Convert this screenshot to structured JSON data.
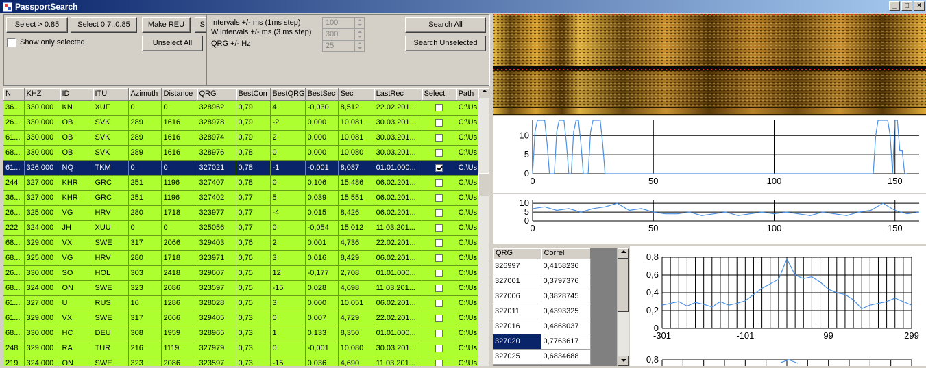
{
  "window": {
    "title": "PassportSearch"
  },
  "toolbar": {
    "select_085": "Select > 0.85",
    "select_07_085": "Select 0.7..0.85",
    "make_reu": "Make REU",
    "s_partial": "S",
    "show_only_selected": "Show only selected",
    "unselect_all": "Unselect All",
    "search_all": "Search All",
    "search_unselected": "Search Unselected"
  },
  "params": {
    "intervals_label": "Intervals +/- ms (1ms step)",
    "intervals_value": "100",
    "w_intervals_label": "W.Intervals +/- ms (3 ms step)",
    "w_intervals_value": "300",
    "qrg_label": "QRG +/- Hz",
    "qrg_value": "25"
  },
  "grid": {
    "columns": [
      "N",
      "KHZ",
      "ID",
      "ITU",
      "Azimuth",
      "Distance",
      "QRG",
      "BestCorr",
      "BestQRG",
      "BestSec",
      "Sec",
      "LastRec",
      "Select",
      "Path"
    ],
    "rows": [
      [
        "36...",
        "330.000",
        "KN",
        "XUF",
        "0",
        "0",
        "328962",
        "0,79",
        "4",
        "-0,030",
        "8,512",
        "22.02.201...",
        false,
        "C:\\Us"
      ],
      [
        "26...",
        "330.000",
        "OB",
        "SVK",
        "289",
        "1616",
        "328978",
        "0,79",
        "-2",
        "0,000",
        "10,081",
        "30.03.201...",
        false,
        "C:\\Us"
      ],
      [
        "61...",
        "330.000",
        "OB",
        "SVK",
        "289",
        "1616",
        "328974",
        "0,79",
        "2",
        "0,000",
        "10,081",
        "30.03.201...",
        false,
        "C:\\Us"
      ],
      [
        "68...",
        "330.000",
        "OB",
        "SVK",
        "289",
        "1616",
        "328976",
        "0,78",
        "0",
        "0,000",
        "10,080",
        "30.03.201...",
        false,
        "C:\\Us"
      ],
      [
        "61...",
        "326.000",
        "NQ",
        "TKM",
        "0",
        "0",
        "327021",
        "0,78",
        "-1",
        "-0,001",
        "8,087",
        "01.01.000...",
        true,
        "C:\\Us"
      ],
      [
        "244",
        "327.000",
        "KHR",
        "GRC",
        "251",
        "1196",
        "327407",
        "0,78",
        "0",
        "0,106",
        "15,486",
        "06.02.201...",
        false,
        "C:\\Us"
      ],
      [
        "36...",
        "327.000",
        "KHR",
        "GRC",
        "251",
        "1196",
        "327402",
        "0,77",
        "5",
        "0,039",
        "15,551",
        "06.02.201...",
        false,
        "C:\\Us"
      ],
      [
        "26...",
        "325.000",
        "VG",
        "HRV",
        "280",
        "1718",
        "323977",
        "0,77",
        "-4",
        "0,015",
        "8,426",
        "06.02.201...",
        false,
        "C:\\Us"
      ],
      [
        "222",
        "324.000",
        "JH",
        "XUU",
        "0",
        "0",
        "325056",
        "0,77",
        "0",
        "-0,054",
        "15,012",
        "11.03.201...",
        false,
        "C:\\Us"
      ],
      [
        "68...",
        "329.000",
        "VX",
        "SWE",
        "317",
        "2066",
        "329403",
        "0,76",
        "2",
        "0,001",
        "4,736",
        "22.02.201...",
        false,
        "C:\\Us"
      ],
      [
        "68...",
        "325.000",
        "VG",
        "HRV",
        "280",
        "1718",
        "323971",
        "0,76",
        "3",
        "0,016",
        "8,429",
        "06.02.201...",
        false,
        "C:\\Us"
      ],
      [
        "26...",
        "330.000",
        "SO",
        "HOL",
        "303",
        "2418",
        "329607",
        "0,75",
        "12",
        "-0,177",
        "2,708",
        "01.01.000...",
        false,
        "C:\\Us"
      ],
      [
        "68...",
        "324.000",
        "ON",
        "SWE",
        "323",
        "2086",
        "323597",
        "0,75",
        "-15",
        "0,028",
        "4,698",
        "11.03.201...",
        false,
        "C:\\Us"
      ],
      [
        "61...",
        "327.000",
        "U",
        "RUS",
        "16",
        "1286",
        "328028",
        "0,75",
        "3",
        "0,000",
        "10,051",
        "06.02.201...",
        false,
        "C:\\Us"
      ],
      [
        "61...",
        "329.000",
        "VX",
        "SWE",
        "317",
        "2066",
        "329405",
        "0,73",
        "0",
        "0,007",
        "4,729",
        "22.02.201...",
        false,
        "C:\\Us"
      ],
      [
        "68...",
        "330.000",
        "HC",
        "DEU",
        "308",
        "1959",
        "328965",
        "0,73",
        "1",
        "0,133",
        "8,350",
        "01.01.000...",
        false,
        "C:\\Us"
      ],
      [
        "248",
        "329.000",
        "RA",
        "TUR",
        "216",
        "1119",
        "327979",
        "0,73",
        "0",
        "-0,001",
        "10,080",
        "30.03.201...",
        false,
        "C:\\Us"
      ],
      [
        "219",
        "324.000",
        "ON",
        "SWE",
        "323",
        "2086",
        "323597",
        "0,73",
        "-15",
        "0,036",
        "4,690",
        "11.03.201...",
        false,
        "C:\\Us"
      ]
    ]
  },
  "corr_list": {
    "columns": [
      "QRG",
      "Correl"
    ],
    "rows": [
      [
        "326997",
        "0,4158236"
      ],
      [
        "327001",
        "0,3797376"
      ],
      [
        "327006",
        "0,3828745"
      ],
      [
        "327011",
        "0,4393325"
      ],
      [
        "327016",
        "0,4868037"
      ],
      [
        "327020",
        "0,7763617"
      ],
      [
        "327025",
        "0,6834688"
      ]
    ],
    "selected_index": 5
  },
  "colors": {
    "grid_row": "#adff2f",
    "selection": "#0a246a",
    "plot_line": "#4a90e2"
  },
  "chart_data": [
    {
      "type": "line",
      "title": "",
      "x": [
        0,
        1,
        2,
        3,
        4,
        5,
        6,
        7,
        8,
        9,
        10,
        11,
        12,
        13,
        14,
        15,
        16,
        17,
        18,
        19,
        20,
        21,
        22,
        23,
        24,
        25,
        26,
        27,
        28,
        29,
        30,
        140,
        141,
        142,
        143,
        144,
        145,
        146,
        147,
        148,
        149,
        150,
        151,
        152,
        153,
        154,
        155
      ],
      "y": [
        0,
        11,
        14,
        14,
        14,
        14,
        8,
        0,
        0,
        0,
        11,
        14,
        14,
        14,
        8,
        0,
        0,
        11,
        14,
        14,
        8,
        0,
        0,
        0,
        11,
        14,
        14,
        14,
        14,
        8,
        0,
        0,
        0,
        10,
        14,
        14,
        14,
        14,
        14,
        10,
        0,
        14,
        14,
        6,
        6,
        0,
        0
      ],
      "xlim": [
        0,
        160
      ],
      "ylim": [
        0,
        14
      ],
      "xticks": [
        0,
        50,
        100,
        150
      ],
      "yticks": [
        0,
        5,
        10
      ]
    },
    {
      "type": "line",
      "title": "",
      "x": [
        0,
        5,
        10,
        15,
        20,
        25,
        30,
        35,
        40,
        45,
        50,
        55,
        60,
        65,
        70,
        75,
        80,
        85,
        90,
        95,
        100,
        105,
        110,
        115,
        120,
        125,
        130,
        135,
        140,
        145,
        150,
        155,
        160
      ],
      "y": [
        7,
        8,
        6,
        7,
        5,
        7,
        8,
        10,
        6,
        7,
        5,
        4,
        4,
        5,
        3,
        4,
        5,
        3,
        4,
        5,
        4,
        5,
        4,
        3,
        5,
        4,
        3,
        5,
        6,
        10,
        6,
        4,
        5
      ],
      "xlim": [
        0,
        160
      ],
      "ylim": [
        0,
        12
      ],
      "xticks": [
        0,
        50,
        100,
        150
      ],
      "yticks": [
        0,
        5,
        10
      ]
    },
    {
      "type": "line",
      "title": "",
      "x": [
        -301,
        -281,
        -261,
        -241,
        -221,
        -201,
        -181,
        -161,
        -141,
        -121,
        -101,
        -81,
        -61,
        -41,
        -21,
        -1,
        19,
        39,
        59,
        79,
        99,
        119,
        139,
        159,
        179,
        199,
        219,
        239,
        259,
        279,
        299
      ],
      "y": [
        0.26,
        0.28,
        0.3,
        0.25,
        0.29,
        0.27,
        0.24,
        0.3,
        0.26,
        0.28,
        0.31,
        0.38,
        0.45,
        0.5,
        0.55,
        0.78,
        0.6,
        0.56,
        0.58,
        0.52,
        0.44,
        0.4,
        0.38,
        0.32,
        0.22,
        0.26,
        0.28,
        0.3,
        0.34,
        0.3,
        0.26
      ],
      "xlim": [
        -301,
        299
      ],
      "ylim": [
        0,
        0.8
      ],
      "xticks": [
        -301,
        -101,
        99,
        299
      ],
      "yticks": [
        0,
        0.2,
        0.4,
        0.6,
        0.8
      ]
    },
    {
      "type": "line",
      "title": "",
      "yticks": [
        0.8
      ]
    }
  ]
}
